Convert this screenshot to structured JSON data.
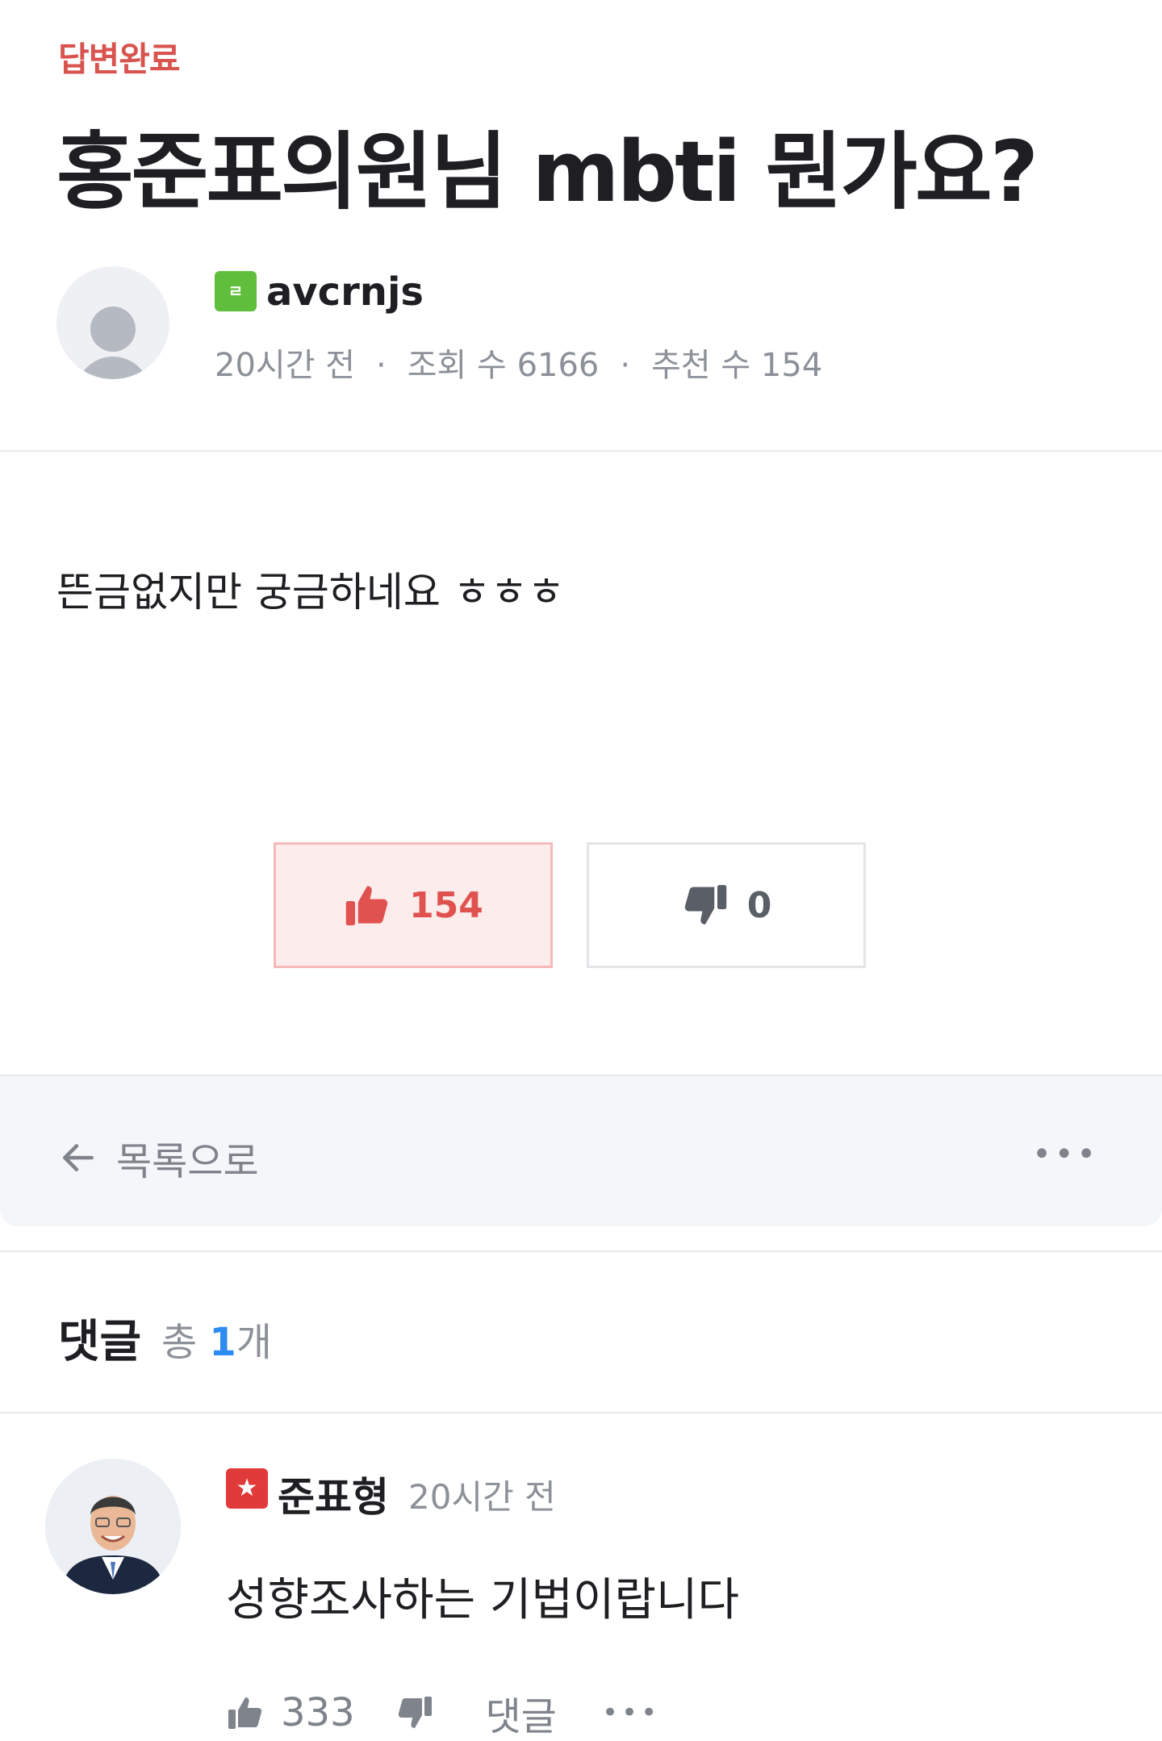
{
  "post": {
    "status": "답변완료",
    "title": "홍준표의원님 mbti 뭔가요?",
    "author": {
      "level_icon": "level-badge-green",
      "level_label": "ㄹ",
      "name": "avcrnjs"
    },
    "meta": {
      "time": "20시간 전",
      "views": "조회 수 6166",
      "recommends": "추천 수 154"
    },
    "body": "뜬금없지만 궁금하네요 ㅎㅎㅎ",
    "votes": {
      "up": "154",
      "down": "0"
    }
  },
  "nav": {
    "back_label": "목록으로",
    "more": "•••"
  },
  "comments": {
    "title": "댓글",
    "count_prefix": "총 ",
    "count": "1",
    "count_suffix": "개",
    "items": [
      {
        "author": "준표형",
        "badge_icon": "star-badge-red",
        "time": "20시간 전",
        "text": "성향조사하는 기법이랍니다",
        "likes": "333",
        "reply_label": "댓글",
        "more": "•••"
      }
    ]
  },
  "colors": {
    "accent_red": "#e0524f",
    "status_red": "#d9534f",
    "count_blue": "#2d8cf0",
    "muted": "#8c9099"
  }
}
